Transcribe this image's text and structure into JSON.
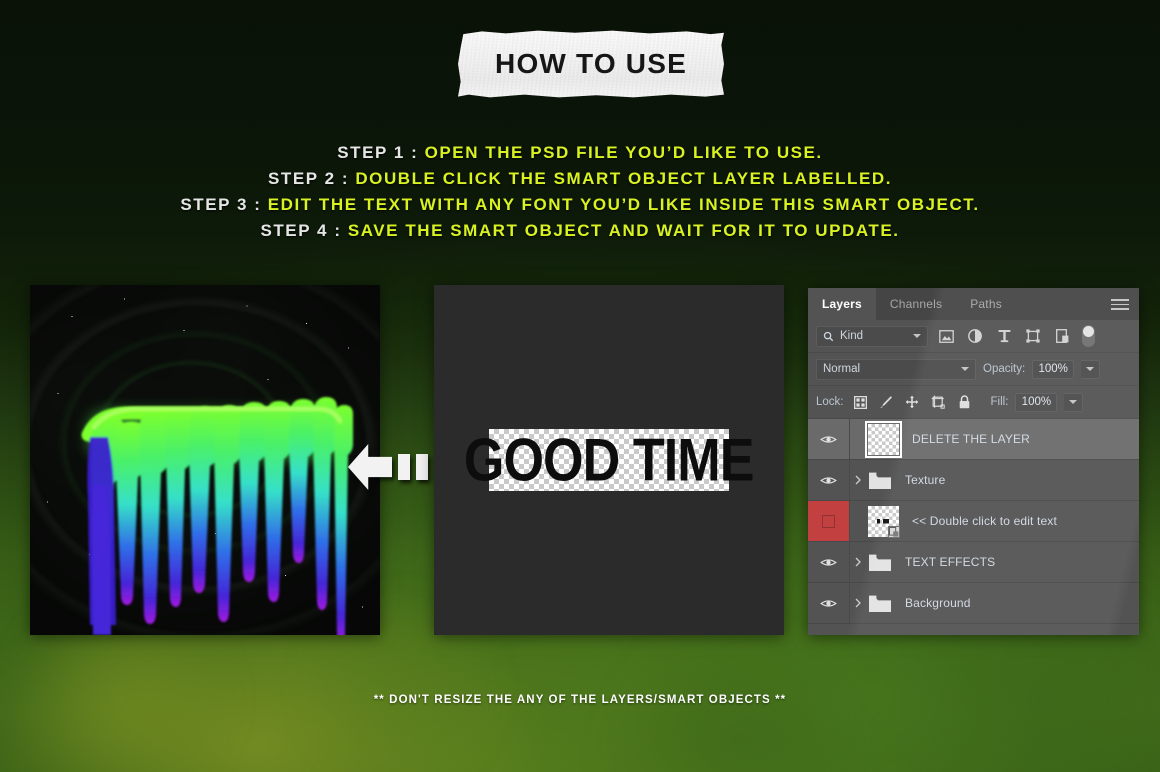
{
  "page": {
    "title": "HOW TO USE",
    "footer_note": "** DON'T RESIZE THE ANY OF THE LAYERS/SMART OBJECTS **",
    "accent_yellow": "#d9f222",
    "label_white": "#e6e6e6",
    "bg_green": "#47721b",
    "bg_dark": "#0a1207"
  },
  "steps": [
    {
      "label": "STEP 1 : ",
      "text": "OPEN THE PSD FILE YOU’D LIKE TO USE."
    },
    {
      "label": "STEP 2 : ",
      "text": "DOUBLE CLICK THE SMART OBJECT LAYER LABELLED."
    },
    {
      "label": "STEP 3 : ",
      "text": "EDIT THE TEXT WITH ANY FONT YOU’D LIKE INSIDE THIS SMART OBJECT."
    },
    {
      "label": "STEP 4 : ",
      "text": "SAVE THE SMART OBJECT AND WAIT FOR IT TO UPDATE."
    }
  ],
  "preview": {
    "left_alt": "neon dripping GOOD TIME artwork on dark space background",
    "mid_text": "GOOD TIME",
    "arrow_direction": "left"
  },
  "photoshop": {
    "tabs": [
      {
        "label": "Layers",
        "active": true
      },
      {
        "label": "Channels",
        "active": false
      },
      {
        "label": "Paths",
        "active": false
      }
    ],
    "menu_icon": "hamburger-icon",
    "filter": {
      "kind_label": "Kind",
      "search_icon": "search-icon",
      "buttons": [
        {
          "name": "filter-pixel-layers",
          "icon": "image-icon"
        },
        {
          "name": "filter-adjustment-layers",
          "icon": "adjustment-icon"
        },
        {
          "name": "filter-type-layers",
          "icon": "type-icon"
        },
        {
          "name": "filter-shape-layers",
          "icon": "shape-icon"
        },
        {
          "name": "filter-smart-objects",
          "icon": "smart-object-icon"
        }
      ],
      "toggle": "filter-enable-toggle"
    },
    "blend": {
      "mode": "Normal",
      "opacity_label": "Opacity:",
      "opacity_value": "100%"
    },
    "lock": {
      "label": "Lock:",
      "icons": [
        {
          "name": "lock-transparent-pixels",
          "icon": "checkerboard-icon"
        },
        {
          "name": "lock-image-pixels",
          "icon": "brush-icon"
        },
        {
          "name": "lock-position",
          "icon": "move-icon"
        },
        {
          "name": "lock-artboard-nesting",
          "icon": "artboard-icon"
        },
        {
          "name": "lock-all",
          "icon": "padlock-icon"
        }
      ],
      "fill_label": "Fill:",
      "fill_value": "100%"
    },
    "layers": [
      {
        "name": "DELETE THE LAYER",
        "type": "thumbnail",
        "selected": true,
        "visible": true,
        "flagged": false,
        "expandable": false,
        "smart_object": false
      },
      {
        "name": "Texture",
        "type": "group",
        "selected": false,
        "visible": true,
        "flagged": false,
        "expandable": true,
        "smart_object": false
      },
      {
        "name": "<< Double click to edit text",
        "type": "thumbnail",
        "selected": false,
        "visible": false,
        "flagged": true,
        "expandable": false,
        "smart_object": true
      },
      {
        "name": "TEXT EFFECTS",
        "type": "group",
        "selected": false,
        "visible": true,
        "flagged": false,
        "expandable": true,
        "smart_object": false
      },
      {
        "name": "Background",
        "type": "group",
        "selected": false,
        "visible": true,
        "flagged": false,
        "expandable": true,
        "smart_object": false
      }
    ]
  }
}
